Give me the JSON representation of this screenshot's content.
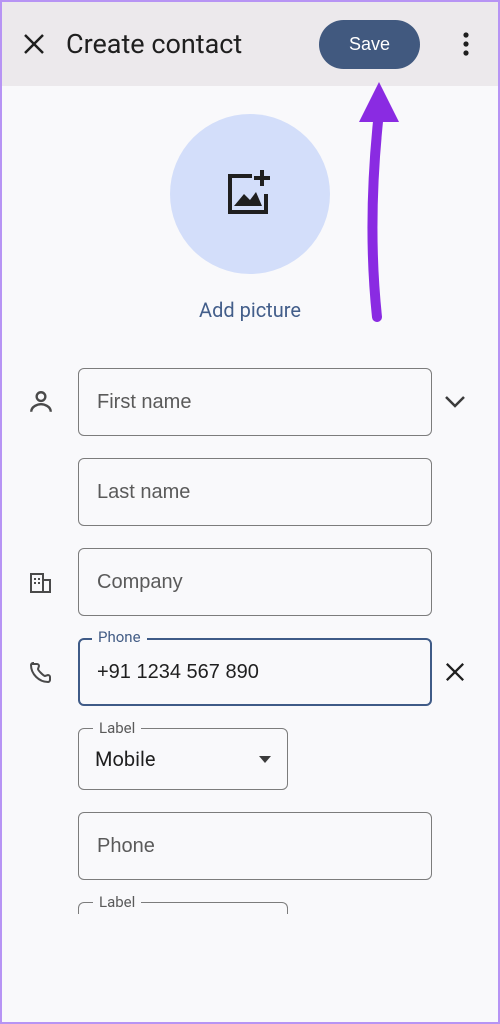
{
  "topbar": {
    "title": "Create contact",
    "save_label": "Save"
  },
  "avatar": {
    "add_picture_label": "Add picture"
  },
  "fields": {
    "first_name_placeholder": "First name",
    "last_name_placeholder": "Last name",
    "company_placeholder": "Company",
    "phone_label": "Phone",
    "phone_value": "+91 1234 567 890",
    "phone_type_label": "Label",
    "phone_type_value": "Mobile",
    "phone2_placeholder": "Phone",
    "phone2_type_label": "Label"
  }
}
